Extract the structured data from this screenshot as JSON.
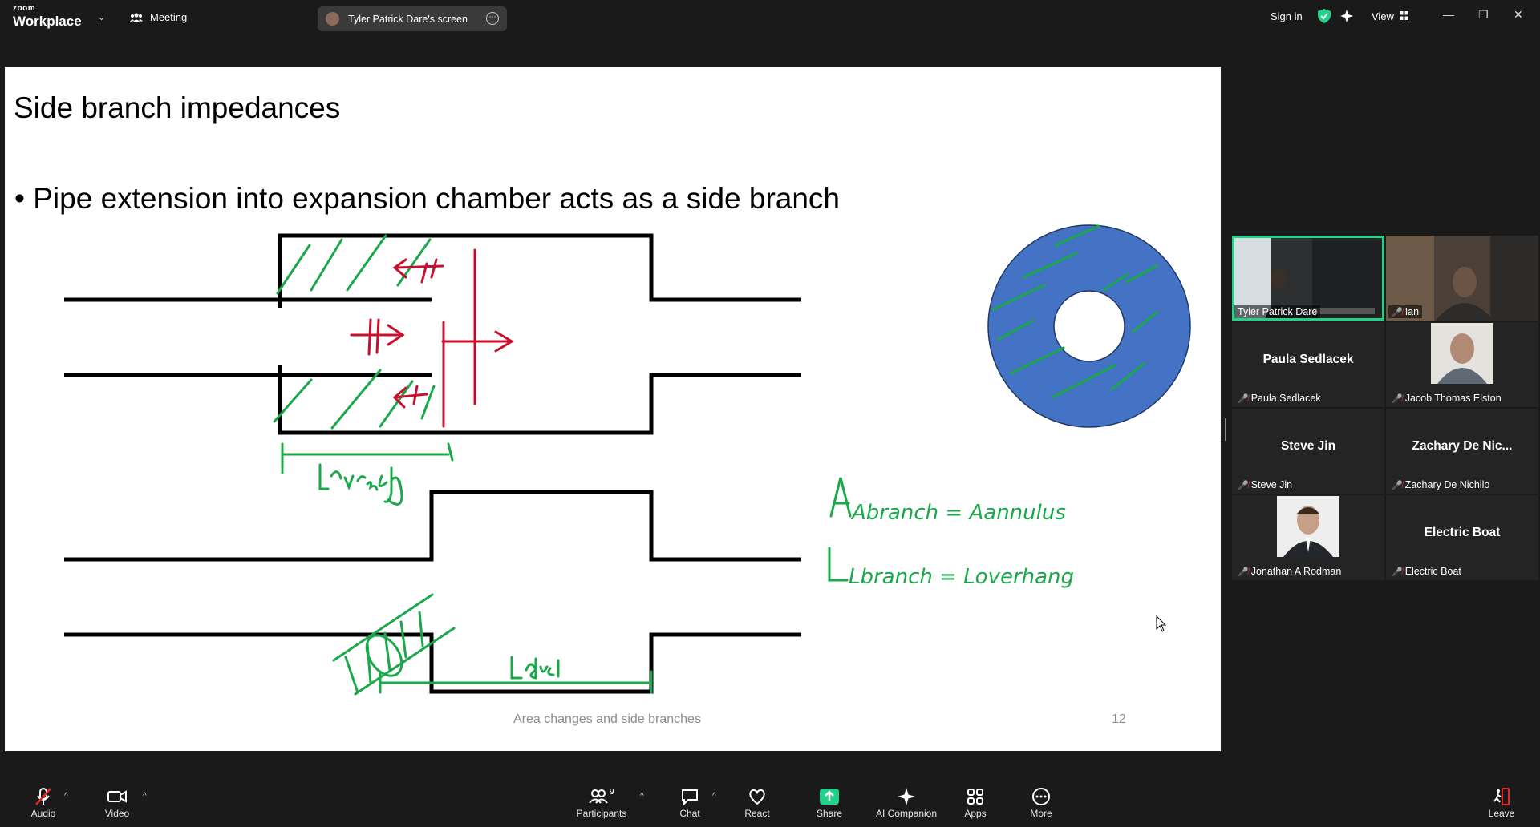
{
  "app": {
    "logo_line1": "zoom",
    "logo_line2": "Workplace",
    "meeting_label": "Meeting",
    "share_pill": "Tyler Patrick Dare's screen",
    "sign_in": "Sign in",
    "view_label": "View",
    "accent": "#23d18b"
  },
  "slide": {
    "title": "Side branch impedances",
    "bullet": "• Pipe extension into expansion chamber acts as a side branch",
    "footer": "Area changes and side branches",
    "page_number": "12",
    "annotations": {
      "overhang_label": "Loverhang",
      "duct_label": "Lduct",
      "eq1": "Abranch = Aannulus",
      "eq2": "Lbranch = Loverhang"
    },
    "colors": {
      "ink_red": "#c8102e",
      "ink_green": "#1aa84a",
      "annulus_blue": "#4472c4"
    }
  },
  "participants": [
    {
      "name": "Tyler Patrick Dare",
      "kind": "video",
      "active": true
    },
    {
      "name": "Ian",
      "kind": "video",
      "muted": true
    },
    {
      "name": "Paula Sedlacek",
      "big": "Paula Sedlacek",
      "muted": true
    },
    {
      "name": "Jacob Thomas Elston",
      "kind": "photo",
      "muted": true
    },
    {
      "name": "Steve Jin",
      "big": "Steve Jin",
      "muted": true
    },
    {
      "name": "Zachary De Nichilo",
      "big": "Zachary De Nic...",
      "muted": true
    },
    {
      "name": "Jonathan A Rodman",
      "kind": "photo",
      "muted": true
    },
    {
      "name": "Electric Boat",
      "big": "Electric Boat",
      "muted": true
    }
  ],
  "toolbar": {
    "audio": "Audio",
    "video": "Video",
    "participants": "Participants",
    "participants_count": "9",
    "chat": "Chat",
    "react": "React",
    "share": "Share",
    "ai_companion": "AI Companion",
    "apps": "Apps",
    "more": "More",
    "leave": "Leave"
  }
}
